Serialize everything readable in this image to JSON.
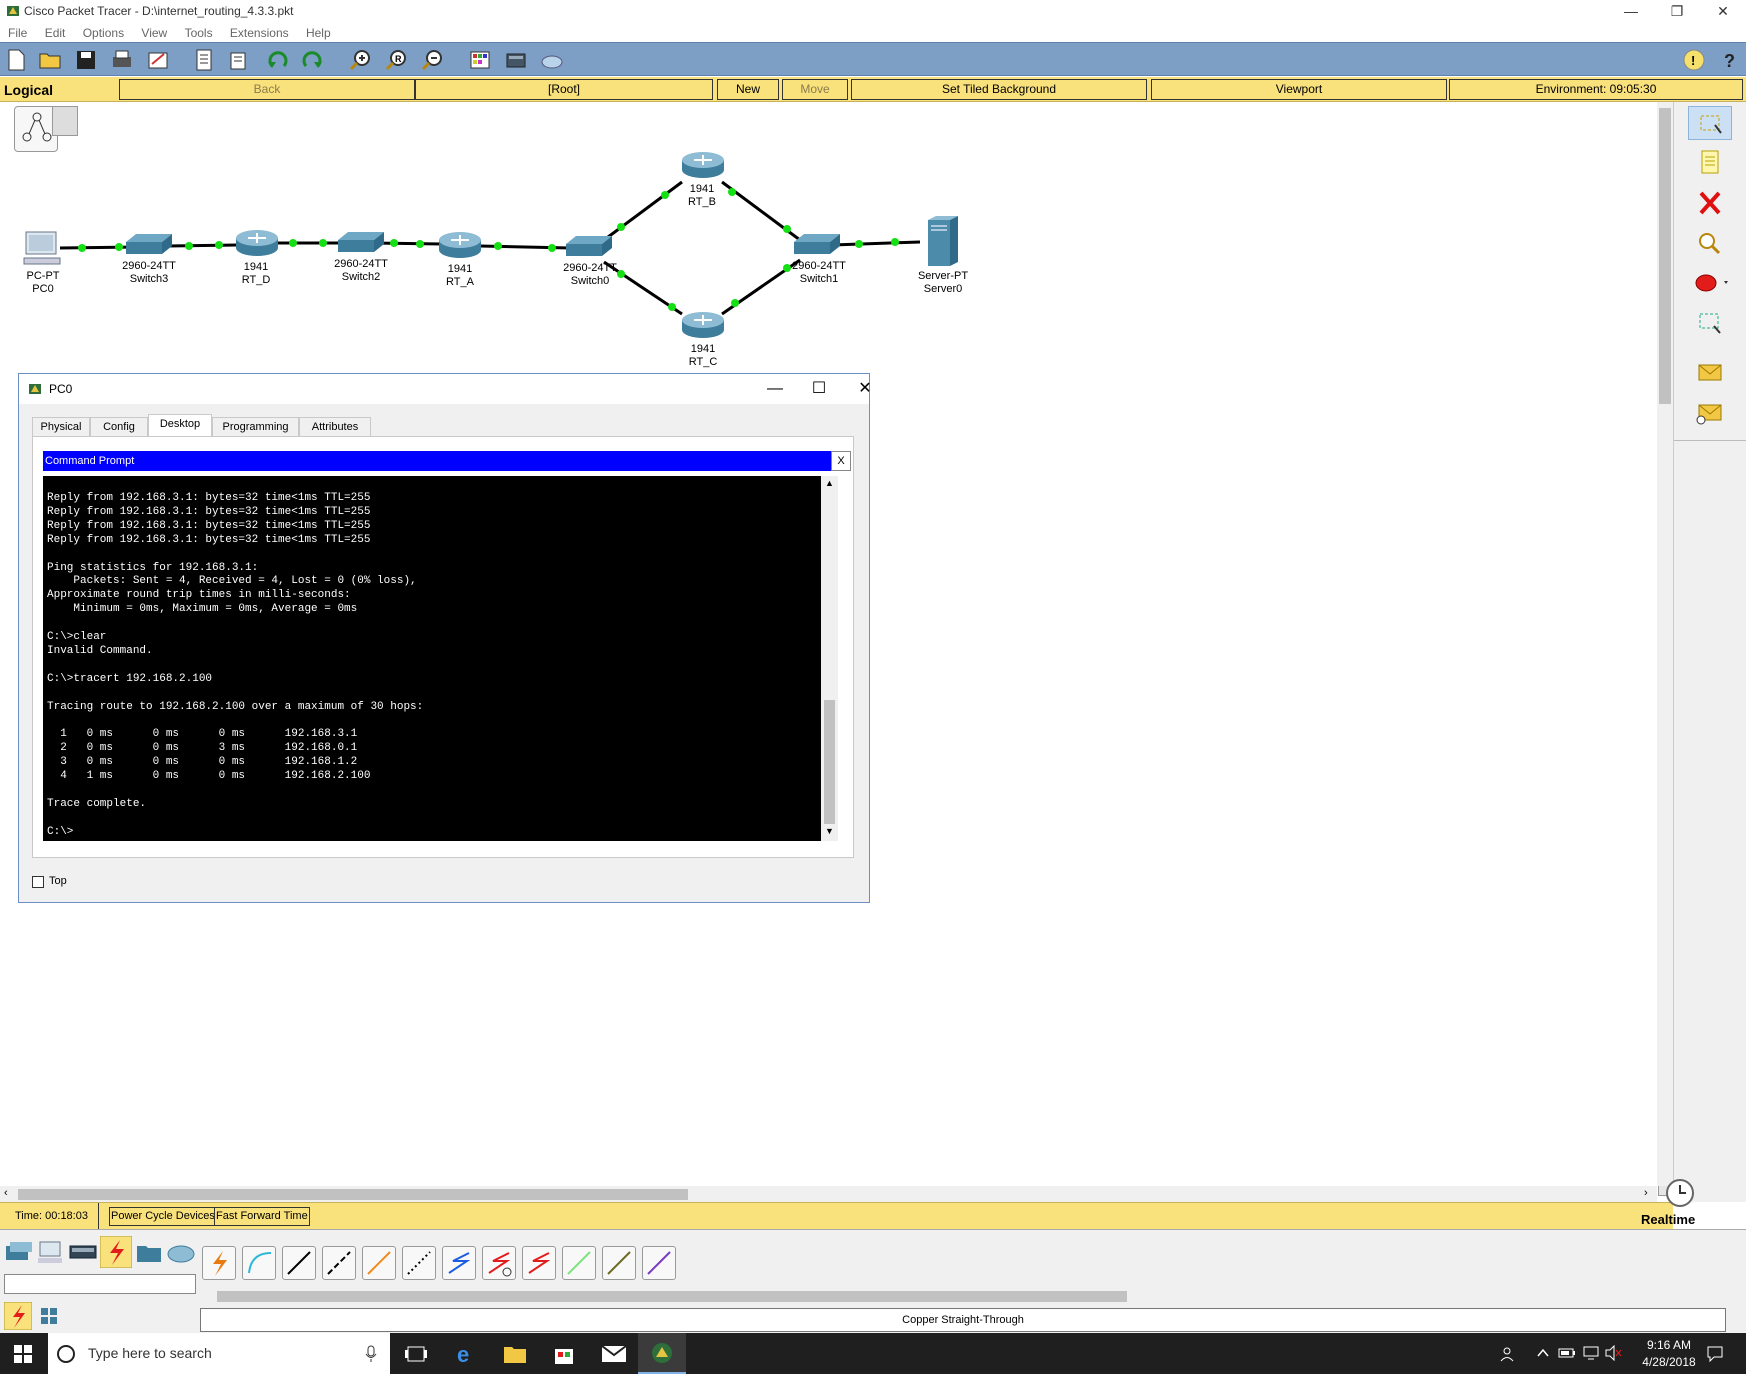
{
  "window": {
    "title": "Cisco Packet Tracer - D:\\internet_routing_4.3.3.pkt",
    "controls": [
      "—",
      "❐",
      "✕"
    ]
  },
  "menu": [
    "File",
    "Edit",
    "Options",
    "View",
    "Tools",
    "Extensions",
    "Help"
  ],
  "toolbar": {
    "icons": [
      "new-file-icon",
      "open-folder-icon",
      "save-icon",
      "print-icon",
      "activity-wizard-icon",
      "inspect-pdu-icon",
      "custom-pdu-icon",
      "undo-icon",
      "redo-icon",
      "zoom-in-icon",
      "zoom-reset-icon",
      "zoom-out-icon",
      "palette-icon",
      "custom-device-icon",
      "cloud-icon"
    ],
    "help_icons": [
      "info-icon",
      "help-icon"
    ],
    "colors": {
      "background": "#7d9fc6"
    }
  },
  "logical_bar": {
    "label": "Logical",
    "back": "Back",
    "root": "[Root]",
    "new_cluster": "New Cluster",
    "move_object": "Move Object",
    "set_tiled_background": "Set Tiled Background",
    "viewport": "Viewport",
    "environment": "Environment: 09:05:30"
  },
  "devices": [
    {
      "id": "pc0",
      "model": "PC-PT",
      "name": "PC0"
    },
    {
      "id": "switch3",
      "model": "2960-24TT",
      "name": "Switch3"
    },
    {
      "id": "rt_d",
      "model": "1941",
      "name": "RT_D"
    },
    {
      "id": "switch2",
      "model": "2960-24TT",
      "name": "Switch2"
    },
    {
      "id": "rt_a",
      "model": "1941",
      "name": "RT_A"
    },
    {
      "id": "switch0",
      "model": "2960-24TT",
      "name": "Switch0"
    },
    {
      "id": "rt_b",
      "model": "1941",
      "name": "RT_B"
    },
    {
      "id": "rt_c",
      "model": "1941",
      "name": "RT_C"
    },
    {
      "id": "switch1",
      "model": "2960-24TT",
      "name": "Switch1"
    },
    {
      "id": "server0",
      "model": "Server-PT",
      "name": "Server0"
    }
  ],
  "pc_window": {
    "title": "PC0",
    "controls": [
      "—",
      "☐",
      "✕"
    ],
    "tabs": [
      "Physical",
      "Config",
      "Desktop",
      "Programming",
      "Attributes"
    ],
    "active_tab": "Desktop",
    "command_prompt": {
      "title": "Command Prompt",
      "close": "X",
      "lines": [
        "Reply from 192.168.3.1: bytes=32 time<1ms TTL=255",
        "Reply from 192.168.3.1: bytes=32 time<1ms TTL=255",
        "Reply from 192.168.3.1: bytes=32 time<1ms TTL=255",
        "Reply from 192.168.3.1: bytes=32 time<1ms TTL=255",
        "",
        "Ping statistics for 192.168.3.1:",
        "    Packets: Sent = 4, Received = 4, Lost = 0 (0% loss),",
        "Approximate round trip times in milli-seconds:",
        "    Minimum = 0ms, Maximum = 0ms, Average = 0ms",
        "",
        "C:\\>clear",
        "Invalid Command.",
        "",
        "C:\\>tracert 192.168.2.100",
        "",
        "Tracing route to 192.168.2.100 over a maximum of 30 hops:",
        "",
        "  1   0 ms      0 ms      0 ms      192.168.3.1",
        "  2   0 ms      0 ms      3 ms      192.168.0.1",
        "  3   0 ms      0 ms      0 ms      192.168.1.2",
        "  4   1 ms      0 ms      0 ms      192.168.2.100",
        "",
        "Trace complete.",
        "",
        "C:\\>"
      ]
    },
    "top_checkbox": "Top"
  },
  "status_bar": {
    "time": "Time: 00:18:03",
    "power_cycle": "Power Cycle Devices",
    "fast_forward": "Fast Forward Time",
    "mode": "Realtime"
  },
  "device_panel": {
    "cable_selected": "Copper Straight-Through",
    "cables": [
      "automatic-connection-icon",
      "console-cable-icon",
      "copper-straight-through-icon",
      "copper-cross-over-icon",
      "fiber-icon",
      "phone-cable-icon",
      "coaxial-cable-icon",
      "serial-dce-icon",
      "serial-dte-icon",
      "octal-cable-icon",
      "iot-custom-cable-icon",
      "usb-cable-icon"
    ]
  },
  "taskbar": {
    "search_placeholder": "Type here to search",
    "time": "9:16 AM",
    "date": "4/28/2018"
  }
}
